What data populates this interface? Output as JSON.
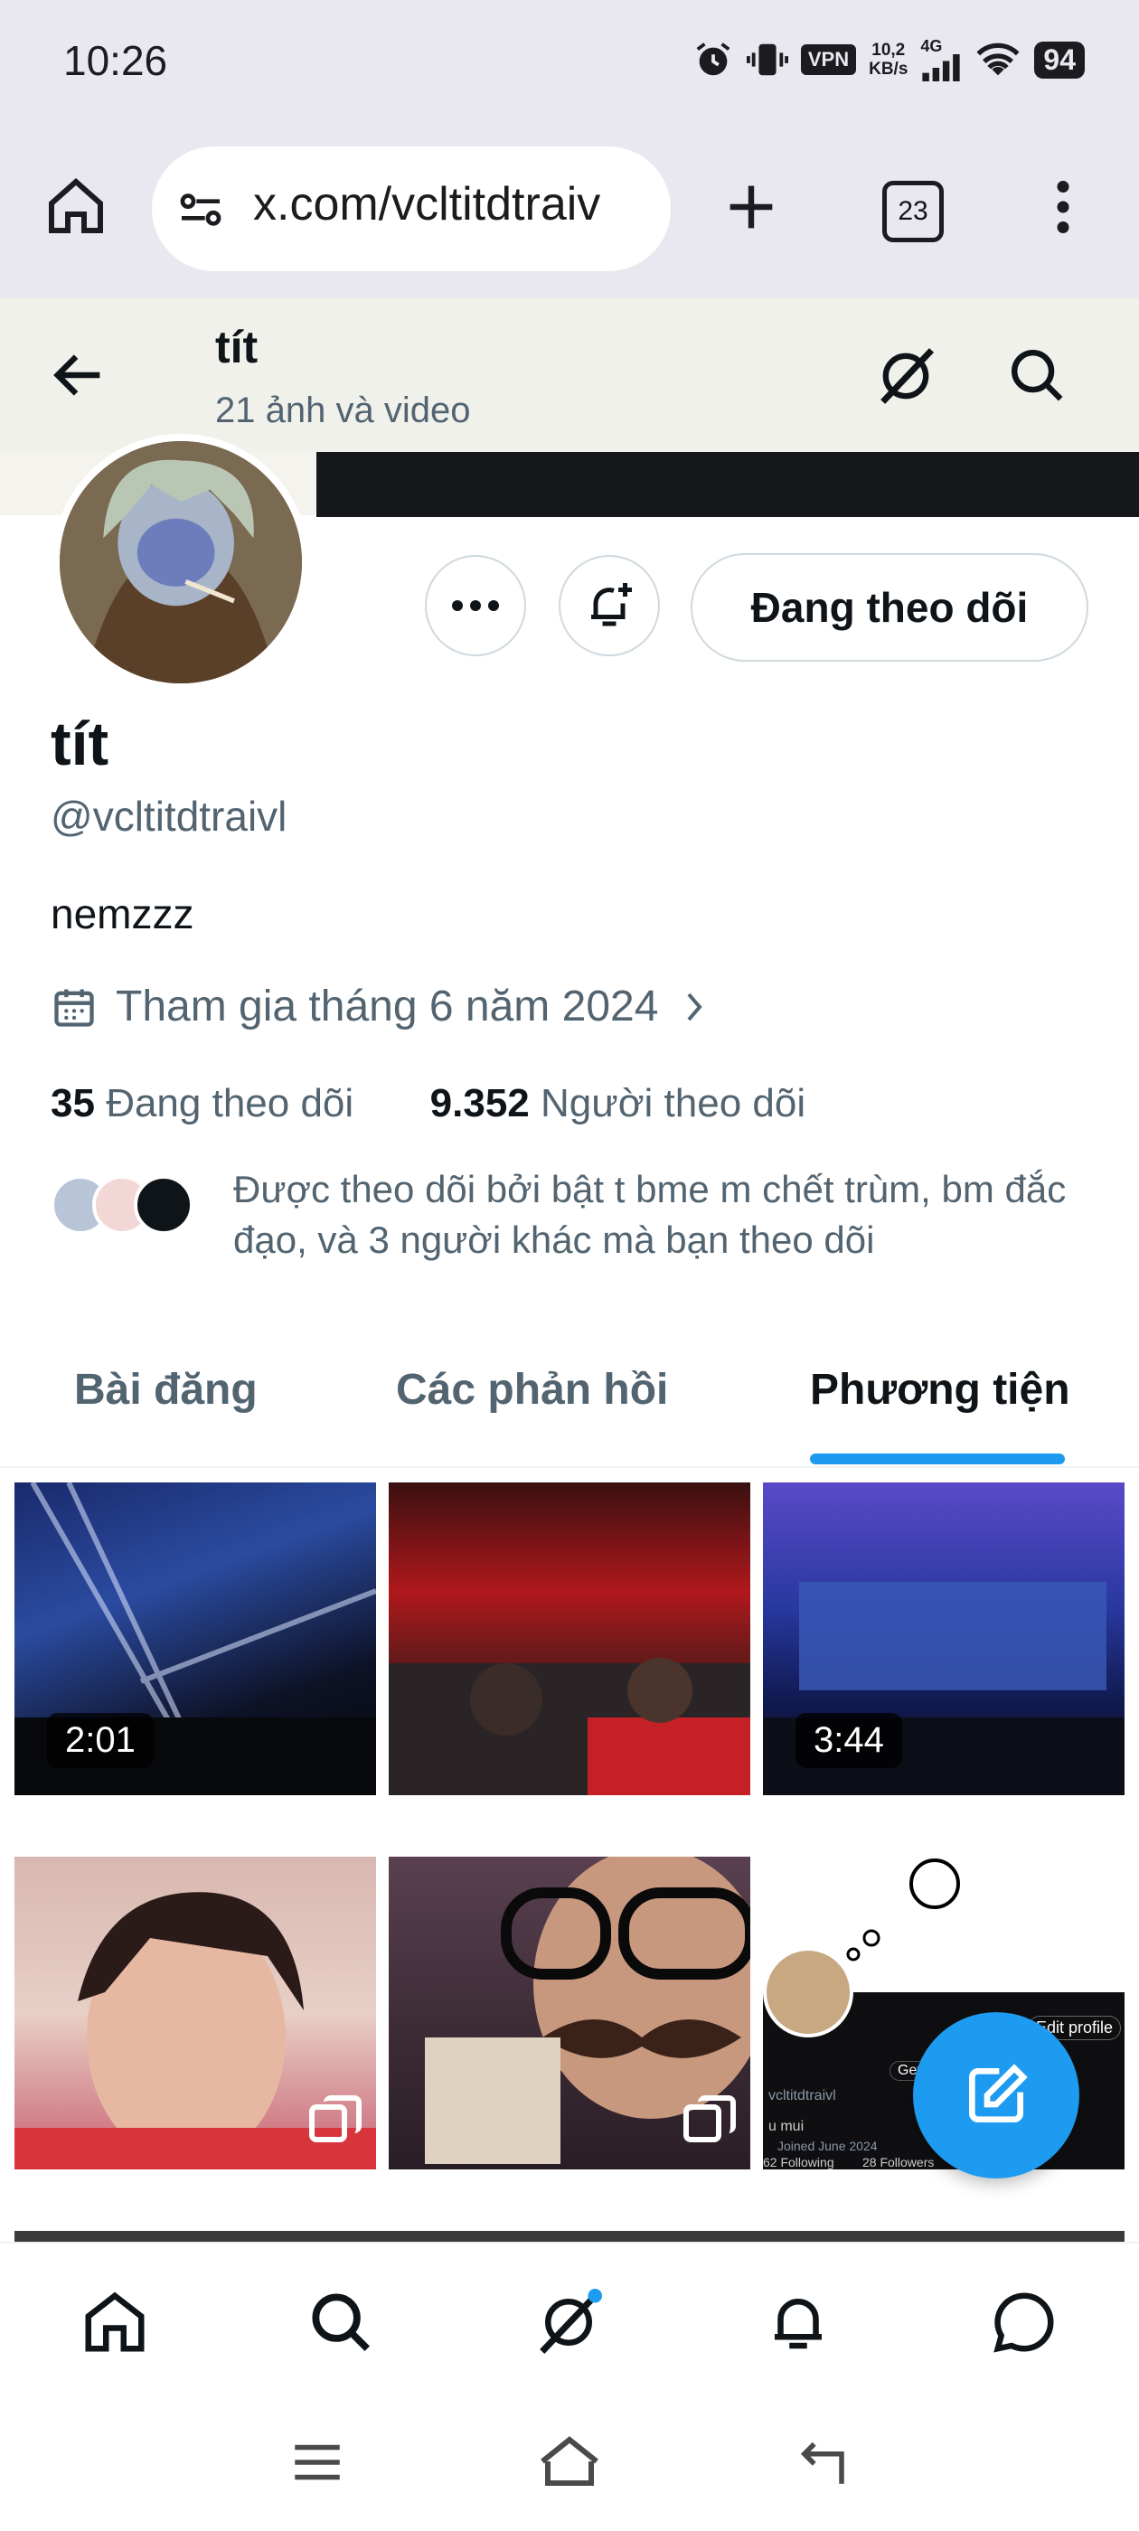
{
  "status_bar": {
    "time": "10:26",
    "vpn": "VPN",
    "net_speed_line1": "10,2",
    "net_speed_line2": "KB/s",
    "network": "4G",
    "battery": "94"
  },
  "browser": {
    "url": "x.com/vcltitdtraiv",
    "tab_count": "23"
  },
  "header": {
    "name": "tít",
    "subtitle": "21 ảnh và video"
  },
  "profile": {
    "name": "tít",
    "handle": "@vcltitdtraivl",
    "bio": "nemzzz",
    "joined": "Tham gia tháng 6 năm 2024",
    "following_count": "35",
    "following_label": "Đang theo dõi",
    "followers_count": "9.352",
    "followers_label": "Người theo dõi",
    "followed_by": "Được theo dõi bởi bật t bme m chết trùm, bm đắc đạo, và 3 người khác mà bạn theo dõi",
    "follow_button": "Đang theo dõi"
  },
  "tabs": [
    {
      "label": "Bài đăng"
    },
    {
      "label": "Các phản hồi"
    },
    {
      "label": "Phương tiện"
    }
  ],
  "active_tab": "Phương tiện",
  "media": [
    {
      "type": "video",
      "duration": "2:01"
    },
    {
      "type": "image"
    },
    {
      "type": "video",
      "duration": "3:44"
    },
    {
      "type": "multi-image"
    },
    {
      "type": "multi-image"
    },
    {
      "type": "image",
      "overlay_text": [
        "Edit profile",
        "Get",
        "vcltitdtraivl",
        "u mui",
        "Joined June 2024",
        "62 Following",
        "28 Followers"
      ]
    }
  ],
  "colors": {
    "accent": "#1d9bf0",
    "text_primary": "#0f1419",
    "text_secondary": "#536471",
    "browser_bg": "#e9e8f0"
  },
  "icons": [
    "home-icon",
    "site-settings-icon",
    "plus-icon",
    "menu-icon",
    "back-icon",
    "grok-icon",
    "search-icon",
    "more-icon",
    "bell-plus-icon",
    "calendar-icon",
    "chevron-right-icon",
    "compose-icon",
    "bell-icon",
    "message-icon"
  ]
}
